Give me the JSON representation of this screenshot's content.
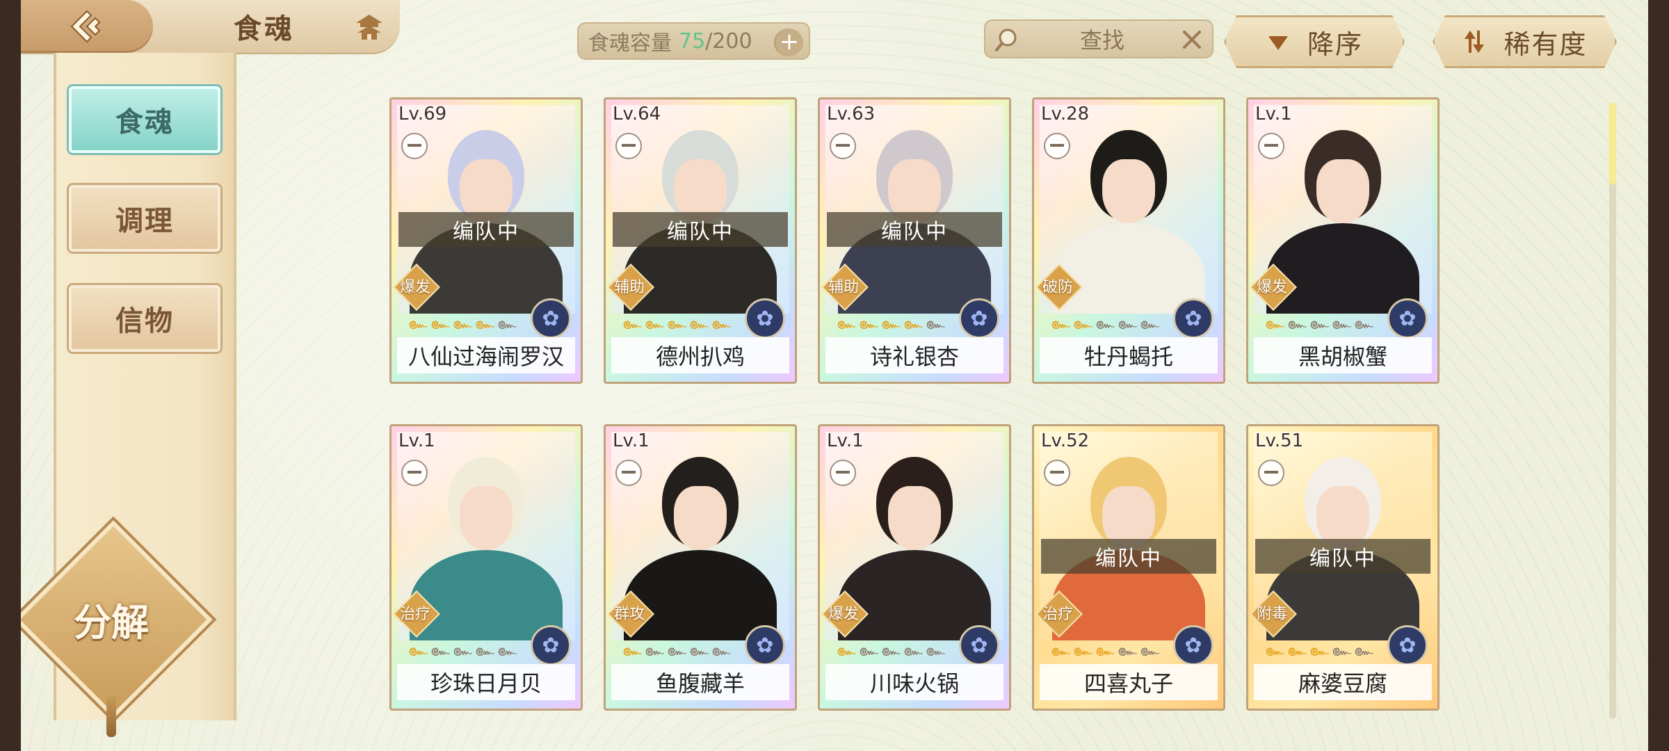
{
  "header": {
    "title": "食魂",
    "back_icon": "back-arrow-icon",
    "home_icon": "pagoda-home-icon"
  },
  "capacity": {
    "label": "食魂容量",
    "current": "75",
    "max": "/200",
    "plus": "+"
  },
  "search": {
    "text": "查找"
  },
  "sort": {
    "order_label": "降序",
    "rarity_label": "稀有度"
  },
  "sidebar": {
    "items": [
      {
        "label": "食魂",
        "active": true
      },
      {
        "label": "调理",
        "active": false
      },
      {
        "label": "信物",
        "active": false
      }
    ],
    "decompose_label": "分解"
  },
  "cards": [
    {
      "level": "Lv.69",
      "name": "八仙过海闹罗汉",
      "role": "爆发",
      "team": "编队中",
      "stars_on": 4,
      "frame": "rainbow",
      "hair": "#c9cde8",
      "outfit": "#3b3a36"
    },
    {
      "level": "Lv.64",
      "name": "德州扒鸡",
      "role": "辅助",
      "team": "编队中",
      "stars_on": 5,
      "frame": "rainbow",
      "hair": "#d8dcd8",
      "outfit": "#2b2a26"
    },
    {
      "level": "Lv.63",
      "name": "诗礼银杏",
      "role": "辅助",
      "team": "编队中",
      "stars_on": 4,
      "frame": "rainbow",
      "hair": "#cfc8cc",
      "outfit": "#3c4052"
    },
    {
      "level": "Lv.28",
      "name": "牡丹蝎托",
      "role": "破防",
      "team": "",
      "stars_on": 2,
      "frame": "rainbow",
      "hair": "#1e1c18",
      "outfit": "#f2efe6"
    },
    {
      "level": "Lv.1",
      "name": "黑胡椒蟹",
      "role": "爆发",
      "team": "",
      "stars_on": 1,
      "frame": "rainbow",
      "hair": "#3a2c26",
      "outfit": "#1f1d1f"
    },
    {
      "level": "Lv.1",
      "name": "珍珠日月贝",
      "role": "治疗",
      "team": "",
      "stars_on": 1,
      "frame": "rainbow",
      "hair": "#f1ecd8",
      "outfit": "#3a8b8a"
    },
    {
      "level": "Lv.1",
      "name": "鱼腹藏羊",
      "role": "群攻",
      "team": "",
      "stars_on": 1,
      "frame": "rainbow",
      "hair": "#231f1c",
      "outfit": "#1a1816"
    },
    {
      "level": "Lv.1",
      "name": "川味火锅",
      "role": "爆发",
      "team": "",
      "stars_on": 1,
      "frame": "rainbow",
      "hair": "#2a1f1b",
      "outfit": "#2a2424"
    },
    {
      "level": "Lv.52",
      "name": "四喜丸子",
      "role": "治疗",
      "team": "编队中",
      "stars_on": 3,
      "frame": "gold",
      "hair": "#f0c873",
      "outfit": "#e06a3c"
    },
    {
      "level": "Lv.51",
      "name": "麻婆豆腐",
      "role": "附毒",
      "team": "编队中",
      "stars_on": 3,
      "frame": "gold",
      "hair": "#f3eee8",
      "outfit": "#3c3a38"
    }
  ],
  "colors": {
    "accent_teal": "#86d3c8",
    "capacity_current": "#62c48a",
    "gold_frame": "#ffd98a"
  }
}
